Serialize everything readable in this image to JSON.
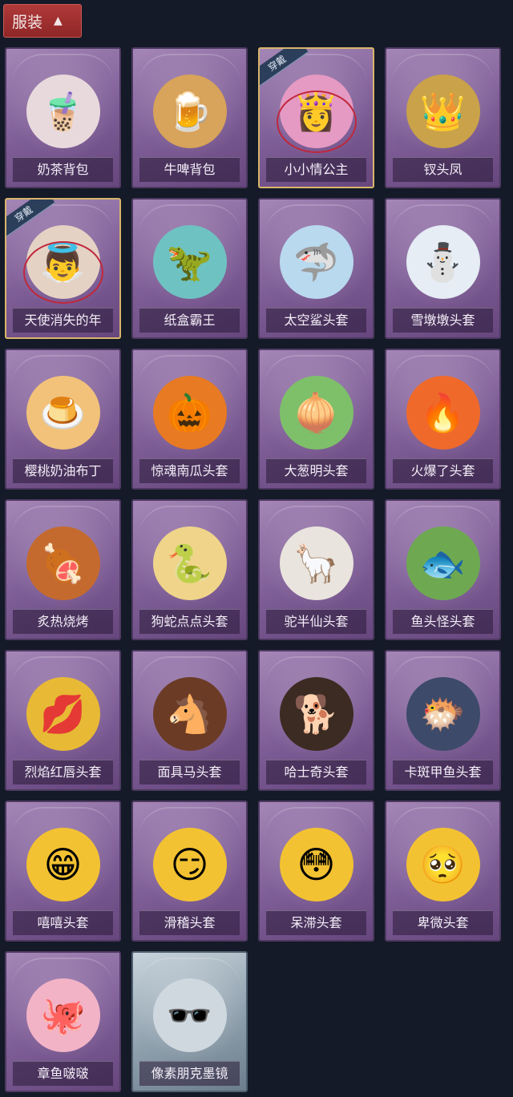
{
  "header": {
    "label": "服装"
  },
  "badge_text": "穿戴",
  "items": [
    {
      "label": "奶茶背包",
      "icon": "milk-tea-backpack-icon",
      "art": "🧋",
      "art_bg": "#e8d9dc",
      "equipped": false,
      "gray": false
    },
    {
      "label": "牛啤背包",
      "icon": "beer-barrel-backpack-icon",
      "art": "🍺",
      "art_bg": "#d8a35a",
      "equipped": false,
      "gray": false
    },
    {
      "label": "小小情公主",
      "icon": "little-princess-icon",
      "art": "👸",
      "art_bg": "#e59ac3",
      "equipped": true,
      "gray": false
    },
    {
      "label": "钗头凤",
      "icon": "phoenix-hairpin-icon",
      "art": "👑",
      "art_bg": "#c9a24a",
      "equipped": false,
      "gray": false
    },
    {
      "label": "天使消失的年",
      "icon": "angel-girl-icon",
      "art": "👼",
      "art_bg": "#e4d2c4",
      "equipped": true,
      "gray": false
    },
    {
      "label": "纸盒霸王",
      "icon": "cardboard-dino-icon",
      "art": "🦖",
      "art_bg": "#6fc2c2",
      "equipped": false,
      "gray": false
    },
    {
      "label": "太空鲨头套",
      "icon": "space-shark-icon",
      "art": "🦈",
      "art_bg": "#b9d9ee",
      "equipped": false,
      "gray": false
    },
    {
      "label": "雪墩墩头套",
      "icon": "snowman-reindeer-icon",
      "art": "⛄",
      "art_bg": "#e6edf5",
      "equipped": false,
      "gray": false
    },
    {
      "label": "樱桃奶油布丁",
      "icon": "cherry-pudding-icon",
      "art": "🍮",
      "art_bg": "#f2c27a",
      "equipped": false,
      "gray": false
    },
    {
      "label": "惊魂南瓜头套",
      "icon": "pumpkin-icon",
      "art": "🎃",
      "art_bg": "#e77a22",
      "equipped": false,
      "gray": false
    },
    {
      "label": "大葱明头套",
      "icon": "scallion-icon",
      "art": "🧅",
      "art_bg": "#7ec06a",
      "equipped": false,
      "gray": false
    },
    {
      "label": "火爆了头套",
      "icon": "fireball-icon",
      "art": "🔥",
      "art_bg": "#ef6a2a",
      "equipped": false,
      "gray": false
    },
    {
      "label": "炙热烧烤",
      "icon": "bbq-meat-icon",
      "art": "🍖",
      "art_bg": "#c56a2e",
      "equipped": false,
      "gray": false
    },
    {
      "label": "狗蛇点点头套",
      "icon": "dog-snake-icon",
      "art": "🐍",
      "art_bg": "#f0d48a",
      "equipped": false,
      "gray": false
    },
    {
      "label": "驼半仙头套",
      "icon": "alpaca-sunglasses-icon",
      "art": "🦙",
      "art_bg": "#e9e4dd",
      "equipped": false,
      "gray": false
    },
    {
      "label": "鱼头怪头套",
      "icon": "fish-head-icon",
      "art": "🐟",
      "art_bg": "#6ea952",
      "equipped": false,
      "gray": false
    },
    {
      "label": "烈焰红唇头套",
      "icon": "red-lips-mask-icon",
      "art": "💋",
      "art_bg": "#e8b935",
      "equipped": false,
      "gray": false
    },
    {
      "label": "面具马头套",
      "icon": "horse-mask-icon",
      "art": "🐴",
      "art_bg": "#6b3b25",
      "equipped": false,
      "gray": false
    },
    {
      "label": "哈士奇头套",
      "icon": "husky-sunglasses-icon",
      "art": "🐕",
      "art_bg": "#3b2b22",
      "equipped": false,
      "gray": false
    },
    {
      "label": "卡斑甲鱼头套",
      "icon": "spotted-fish-icon",
      "art": "🐡",
      "art_bg": "#3d4a6a",
      "equipped": false,
      "gray": false
    },
    {
      "label": "嘻嘻头套",
      "icon": "grin-emoji-icon",
      "art": "😁",
      "art_bg": "#f3c232",
      "equipped": false,
      "gray": false
    },
    {
      "label": "滑稽头套",
      "icon": "funny-emoji-icon",
      "art": "😏",
      "art_bg": "#f3c232",
      "equipped": false,
      "gray": false
    },
    {
      "label": "呆滞头套",
      "icon": "dazed-emoji-icon",
      "art": "😳",
      "art_bg": "#f3c232",
      "equipped": false,
      "gray": false
    },
    {
      "label": "卑微头套",
      "icon": "humble-emoji-icon",
      "art": "🥺",
      "art_bg": "#f3c232",
      "equipped": false,
      "gray": false
    },
    {
      "label": "章鱼啵啵",
      "icon": "octopus-icon",
      "art": "🐙",
      "art_bg": "#f2b3c6",
      "equipped": false,
      "gray": false
    },
    {
      "label": "像素朋克墨镜",
      "icon": "pixel-sunglasses-icon",
      "art": "🕶️",
      "art_bg": "#cfd8df",
      "equipped": false,
      "gray": true
    }
  ]
}
